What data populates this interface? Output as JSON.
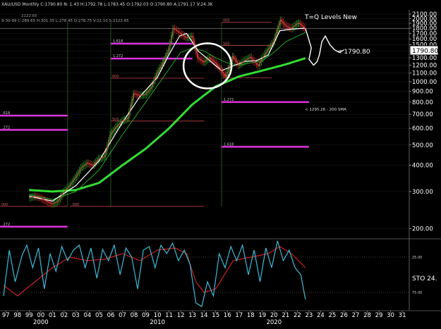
{
  "header": {
    "line1": "XAU/USD  Monthly  C:1790.80  N:  1.43  H:1792.78  L:1783.45  O:1792.03  O:1790.80  A:1791.17  V:24.3K",
    "line2": "2122.65",
    "line3": "9-30-99  C:289.65  H:301.35  L:278.45  O:278.75  V:22.10  S:2122.65"
  },
  "annotations": {
    "title": "T=Q Levels New",
    "price_callout": "< 1790.80",
    "price_marker": "1790.80",
    "sma_label": "< 1295.26 - 200 SMA",
    "oscillator_label": "STO  24."
  },
  "colors": {
    "background": "#000000",
    "price_up": "#1e8a1e",
    "price_down": "#cc2222",
    "sma_fast": "#ffffff",
    "sma_mid": "#22aa22",
    "sma_200": "#33dd33",
    "levels": "#dd33dd",
    "fib_lines": "#c04040",
    "projection": "#ffffff",
    "stoch_k": "#3bbcd8",
    "stoch_d": "#cc2222",
    "circle": "#ffffff"
  },
  "chart_data": {
    "type": "line",
    "scale": "log",
    "ylim": [
      180,
      2200
    ],
    "y_ticks": [
      2100,
      2000,
      1900,
      1800,
      1700,
      1600,
      1500,
      1400,
      1300,
      1200,
      1100,
      1000,
      900,
      800,
      700,
      600,
      500,
      400,
      300,
      200
    ],
    "x_tick_labels": [
      "97",
      "98",
      "99",
      "00",
      "01",
      "02",
      "03",
      "04",
      "05",
      "06",
      "07",
      "08",
      "09",
      "10",
      "11",
      "12",
      "13",
      "14",
      "15",
      "16",
      "17",
      "18",
      "19",
      "20",
      "21",
      "22",
      "23",
      "24",
      "25",
      "26",
      "27",
      "28",
      "29",
      "30",
      "31"
    ],
    "x_decade_labels": [
      {
        "year": 2000,
        "label": "2000"
      },
      {
        "year": 2010,
        "label": "2010"
      },
      {
        "year": 2020,
        "label": "2020"
      }
    ],
    "xlim": [
      1996.5,
      2031.6
    ],
    "price": {
      "x": [
        1999.0,
        1999.5,
        2000.0,
        2000.5,
        2001.0,
        2001.5,
        2002.0,
        2002.5,
        2003.0,
        2003.5,
        2004.0,
        2004.5,
        2005.0,
        2005.5,
        2006.0,
        2006.5,
        2007.0,
        2007.5,
        2008.0,
        2008.5,
        2009.0,
        2009.5,
        2010.0,
        2010.5,
        2011.0,
        2011.4,
        2011.7,
        2012.0,
        2012.5,
        2013.0,
        2013.5,
        2014.0,
        2014.5,
        2015.0,
        2015.9,
        2016.5,
        2017.0,
        2017.5,
        2018.0,
        2018.7,
        2019.0,
        2019.5,
        2020.0,
        2020.6,
        2021.0,
        2021.5,
        2022.0,
        2022.2,
        2022.7
      ],
      "y": [
        280,
        285,
        280,
        270,
        262,
        270,
        300,
        320,
        350,
        390,
        410,
        400,
        430,
        440,
        560,
        610,
        650,
        670,
        880,
        860,
        870,
        940,
        1100,
        1230,
        1420,
        1800,
        1750,
        1700,
        1620,
        1650,
        1300,
        1240,
        1300,
        1230,
        1060,
        1320,
        1200,
        1260,
        1310,
        1190,
        1290,
        1420,
        1550,
        1970,
        1850,
        1790,
        1890,
        1900,
        1790.8
      ]
    },
    "sma_fast": {
      "x": [
        1999.0,
        2001.0,
        2003.0,
        2005.0,
        2007.0,
        2008.5,
        2010.0,
        2011.0,
        2011.9,
        2012.5,
        2013.5,
        2014.5,
        2015.5,
        2016.5,
        2017.5,
        2018.5,
        2019.5,
        2020.5,
        2021.5,
        2022.7
      ],
      "y": [
        285,
        270,
        320,
        420,
        640,
        850,
        1050,
        1350,
        1650,
        1700,
        1400,
        1260,
        1130,
        1190,
        1250,
        1260,
        1340,
        1750,
        1780,
        1800
      ]
    },
    "sma_mid": {
      "x": [
        1999.0,
        2001.0,
        2003.0,
        2005.0,
        2007.0,
        2009.0,
        2011.0,
        2012.0,
        2013.0,
        2014.0,
        2015.0,
        2016.0,
        2017.0,
        2018.0,
        2019.0,
        2020.0,
        2021.0,
        2022.7
      ],
      "y": [
        290,
        275,
        300,
        380,
        560,
        800,
        1150,
        1380,
        1450,
        1400,
        1300,
        1230,
        1200,
        1230,
        1260,
        1380,
        1550,
        1720
      ]
    },
    "sma_200": {
      "x": [
        1999.0,
        2001.0,
        2003.0,
        2005.0,
        2007.0,
        2009.0,
        2011.0,
        2013.0,
        2015.0,
        2017.0,
        2019.0,
        2021.0,
        2022.7
      ],
      "y": [
        305,
        300,
        305,
        330,
        400,
        480,
        600,
        780,
        950,
        1060,
        1130,
        1210,
        1295.26
      ]
    },
    "sma_200_value": 1295.26,
    "projection": {
      "x": [
        2022.7,
        2022.9,
        2023.2,
        2023.0,
        2023.4,
        2023.7,
        2023.9,
        2024.1,
        2024.4,
        2024.8,
        2025.2,
        2025.6,
        2026.0
      ],
      "y": [
        1790,
        1650,
        1450,
        1280,
        1200,
        1250,
        1350,
        1550,
        1650,
        1500,
        1420,
        1380,
        1420
      ]
    },
    "fib_levels": [
      {
        "label": "1.618",
        "value": 1520,
        "x_range": [
          2006.0,
          2013.0
        ]
      },
      {
        "label": "1.272",
        "value": 1290,
        "x_range": [
          2006.0,
          2013.0
        ]
      },
      {
        "label": "1.272",
        "value": 800,
        "x_range": [
          2015.5,
          2023.0
        ]
      },
      {
        "label": "1.618",
        "value": 490,
        "x_range": [
          2015.5,
          2023.0
        ]
      },
      {
        "label": ".618",
        "value": 690,
        "x_range": [
          1996.5,
          2002.3
        ]
      },
      {
        "label": ".272",
        "value": 590,
        "x_range": [
          1996.5,
          2002.3
        ]
      },
      {
        "label": ".272",
        "value": 204,
        "x_range": [
          1996.5,
          2002.3
        ]
      }
    ],
    "fib_guides": [
      {
        "label": "000",
        "value": 1920,
        "x_range": [
          2015.5,
          2019.8
        ]
      },
      {
        "label": "500",
        "value": 1490,
        "x_range": [
          2015.5,
          2019.8
        ]
      },
      {
        "label": "000",
        "value": 1045,
        "x_range": [
          2015.5,
          2019.8
        ]
      },
      {
        "label": "000",
        "value": 1040,
        "x_range": [
          2006.0,
          2014.0
        ]
      },
      {
        "label": "500",
        "value": 650,
        "x_range": [
          2006.0,
          2014.0
        ]
      },
      {
        "label": ".000",
        "value": 255,
        "x_range": [
          2002.5,
          2014.0
        ]
      },
      {
        "label": "000",
        "value": 255,
        "x_range": [
          1996.5,
          2002.3
        ]
      }
    ],
    "circle": {
      "x_center": 2014.3,
      "y_center": 1190
    },
    "stochastic": {
      "ylim": [
        0,
        100
      ],
      "levels": [
        {
          "label": "25.00",
          "value": 75
        },
        {
          "label": "75.00",
          "value": 25
        }
      ],
      "k": {
        "x": [
          1996.8,
          1997.3,
          1997.8,
          1998.4,
          1998.8,
          1999.3,
          1999.8,
          2000.3,
          2000.8,
          2001.3,
          2001.8,
          2002.3,
          2002.8,
          2003.3,
          2003.8,
          2004.3,
          2004.8,
          2005.3,
          2005.8,
          2006.3,
          2006.8,
          2007.3,
          2007.8,
          2008.3,
          2008.8,
          2009.3,
          2009.8,
          2010.3,
          2010.8,
          2011.3,
          2011.8,
          2012.3,
          2012.8,
          2013.3,
          2013.8,
          2014.3,
          2014.8,
          2015.3,
          2015.8,
          2016.3,
          2016.8,
          2017.3,
          2017.8,
          2018.3,
          2018.8,
          2019.3,
          2019.8,
          2020.3,
          2020.8,
          2021.3,
          2021.8,
          2022.3,
          2022.7
        ],
        "y": [
          20,
          85,
          40,
          78,
          92,
          60,
          88,
          30,
          80,
          55,
          90,
          70,
          85,
          92,
          60,
          88,
          45,
          86,
          70,
          92,
          50,
          88,
          75,
          30,
          85,
          90,
          60,
          92,
          80,
          95,
          70,
          85,
          65,
          10,
          5,
          40,
          20,
          80,
          60,
          90,
          70,
          92,
          50,
          85,
          40,
          88,
          60,
          98,
          70,
          85,
          60,
          50,
          15
        ]
      },
      "d": {
        "x": [
          1996.8,
          1998.0,
          1999.5,
          2001.0,
          2002.5,
          2004.0,
          2005.5,
          2007.0,
          2008.5,
          2010.0,
          2011.5,
          2012.5,
          2013.3,
          2014.0,
          2015.0,
          2016.5,
          2018.0,
          2019.5,
          2020.5,
          2021.5,
          2022.7
        ],
        "y": [
          35,
          20,
          40,
          60,
          75,
          70,
          72,
          80,
          70,
          85,
          88,
          80,
          40,
          25,
          30,
          70,
          75,
          80,
          90,
          80,
          60
        ]
      }
    }
  }
}
